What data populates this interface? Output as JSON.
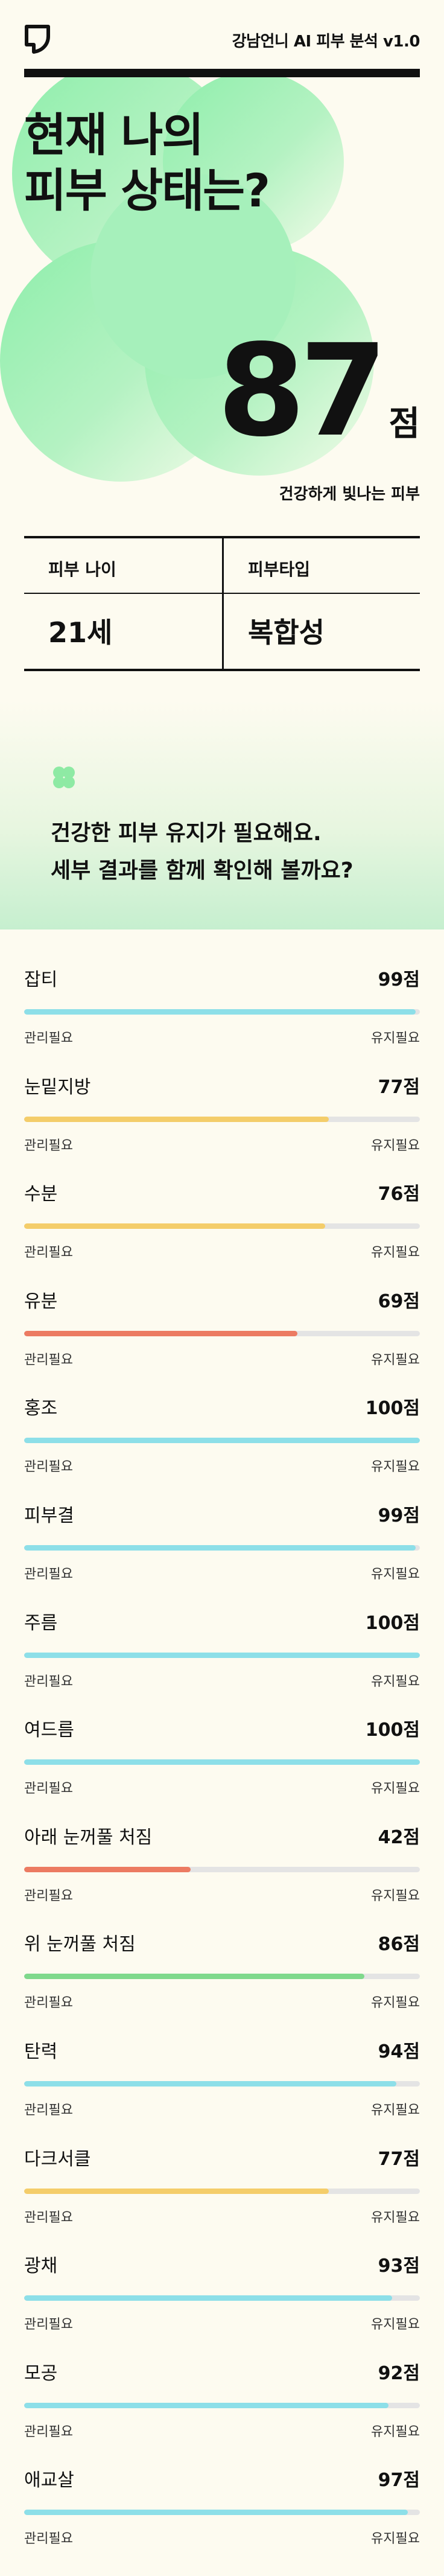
{
  "header": {
    "title": "강남언니 AI 피부 분석 v1.0",
    "logo_icon": "app-logo-icon"
  },
  "hero": {
    "title_line1": "현재 나의",
    "title_line2": "피부 상태는?",
    "score": "87",
    "score_unit": "점",
    "score_caption": "건강하게 빛나는 피부"
  },
  "info": {
    "skin_age_label": "피부 나이",
    "skin_age_value": "21세",
    "skin_type_label": "피부타입",
    "skin_type_value": "복합성"
  },
  "summary": {
    "line1": "건강한 피부 유지가 필요해요.",
    "line2": "세부 결과를 함께 확인해 볼까요?"
  },
  "scale": {
    "low": "관리필요",
    "high": "유지필요"
  },
  "colors": {
    "good": "#8ddfe8",
    "medium": "#f4cd6a",
    "bad": "#ec7b62",
    "great": "#7fd98c",
    "track": "#e4e4e4"
  },
  "metrics": [
    {
      "label": "잡티",
      "value": "99점",
      "score": 99,
      "color": "#8ddfe8"
    },
    {
      "label": "눈밑지방",
      "value": "77점",
      "score": 77,
      "color": "#f4cd6a"
    },
    {
      "label": "수분",
      "value": "76점",
      "score": 76,
      "color": "#f4cd6a"
    },
    {
      "label": "유분",
      "value": "69점",
      "score": 69,
      "color": "#ec7b62"
    },
    {
      "label": "홍조",
      "value": "100점",
      "score": 100,
      "color": "#8ddfe8"
    },
    {
      "label": "피부결",
      "value": "99점",
      "score": 99,
      "color": "#8ddfe8"
    },
    {
      "label": "주름",
      "value": "100점",
      "score": 100,
      "color": "#8ddfe8"
    },
    {
      "label": "여드름",
      "value": "100점",
      "score": 100,
      "color": "#8ddfe8"
    },
    {
      "label": "아래 눈꺼풀 처짐",
      "value": "42점",
      "score": 42,
      "color": "#ec7b62"
    },
    {
      "label": "위 눈꺼풀 처짐",
      "value": "86점",
      "score": 86,
      "color": "#7fd98c"
    },
    {
      "label": "탄력",
      "value": "94점",
      "score": 94,
      "color": "#8ddfe8"
    },
    {
      "label": "다크서클",
      "value": "77점",
      "score": 77,
      "color": "#f4cd6a"
    },
    {
      "label": "광채",
      "value": "93점",
      "score": 93,
      "color": "#8ddfe8"
    },
    {
      "label": "모공",
      "value": "92점",
      "score": 92,
      "color": "#8ddfe8"
    },
    {
      "label": "애교살",
      "value": "97점",
      "score": 97,
      "color": "#8ddfe8"
    }
  ]
}
